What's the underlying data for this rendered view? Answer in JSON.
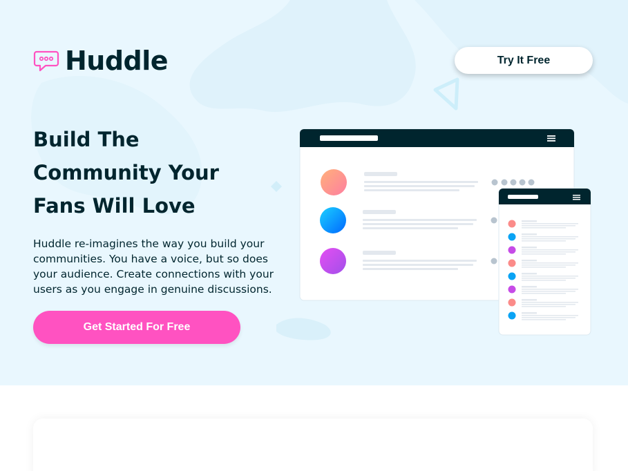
{
  "brand": {
    "name": "Huddle",
    "logo_icon": "chat-bubble-icon",
    "accent": "#ff52c1",
    "dark": "#00252e"
  },
  "header": {
    "try_button": "Try It Free"
  },
  "hero": {
    "headline": "Build The Community Your Fans Will Love",
    "description": "Huddle re-imagines the way you build your communities. You have a voice, but so does your audience. Create connections with your users as you engage in genuine discussions.",
    "cta": "Get Started For Free"
  },
  "illustration": {
    "desktop_avatars": [
      "#fe8a8a/#ffc47a",
      "#0cc2ff/#0068ff",
      "#d84ff5/#a94fe8"
    ],
    "mobile_avatar_colors": [
      "#fb8b89",
      "#0aa3f4",
      "#c64be7",
      "#fb8b89",
      "#0aa3f4",
      "#c64be7",
      "#fb8b89",
      "#0aa3f4"
    ],
    "menu_icon": "hamburger-icon"
  }
}
